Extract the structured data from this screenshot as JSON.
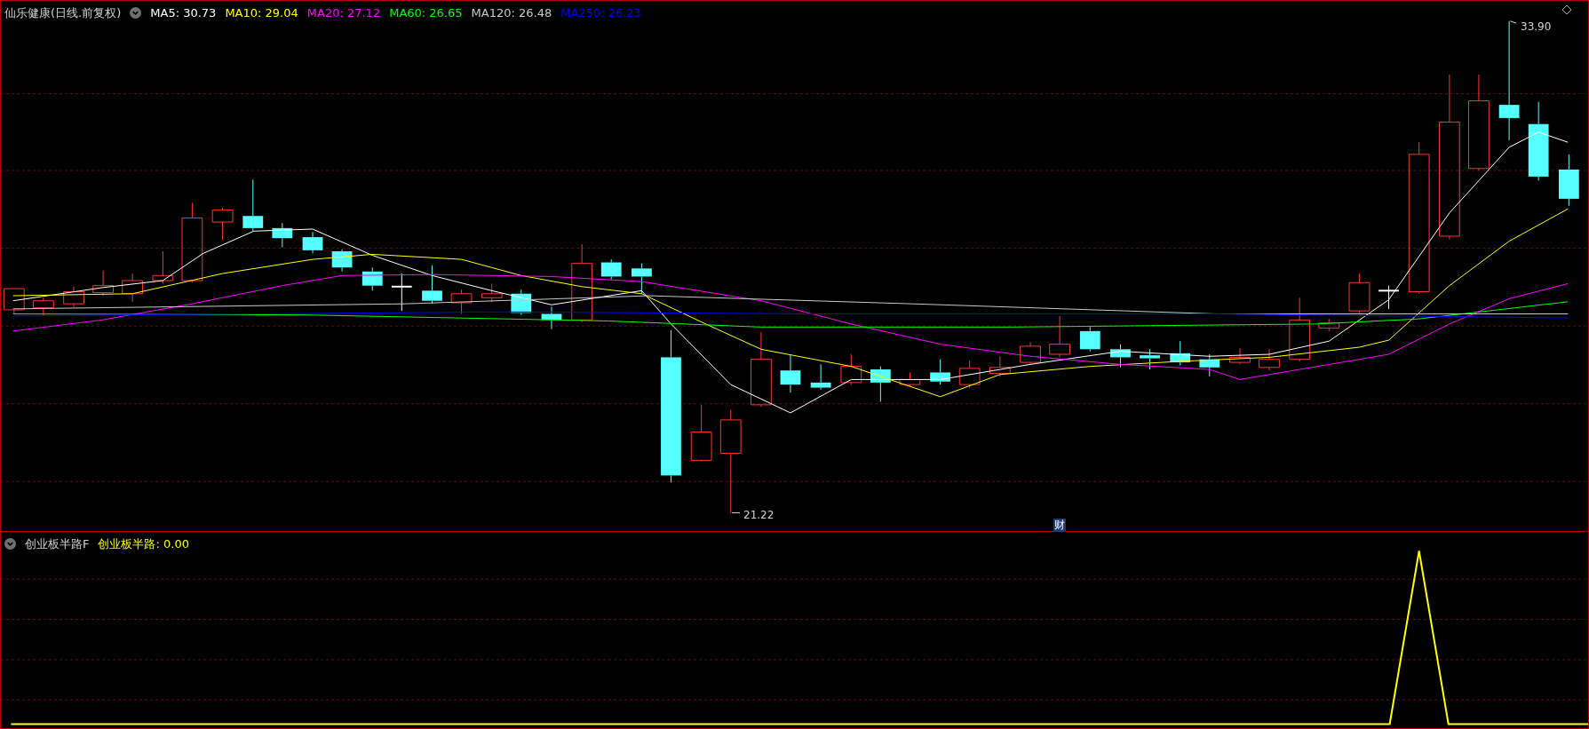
{
  "header": {
    "title": "仙乐健康(日线.前复权)",
    "ma_labels": [
      {
        "text": "MA5: 30.73",
        "color": "#ffffff"
      },
      {
        "text": "MA10: 29.04",
        "color": "#ffff00"
      },
      {
        "text": "MA20: 27.12",
        "color": "#ff00ff"
      },
      {
        "text": "MA60: 26.65",
        "color": "#00ff00"
      },
      {
        "text": "MA120: 26.48",
        "color": "#c8c8c8"
      },
      {
        "text": "MA250: 26.23",
        "color": "#0000ff"
      }
    ]
  },
  "price_marks": {
    "high": "33.90",
    "low": "21.22"
  },
  "event_badge": "财",
  "indicator": {
    "name": "创业板半路F",
    "value_label": "创业板半路: 0.00"
  }
}
